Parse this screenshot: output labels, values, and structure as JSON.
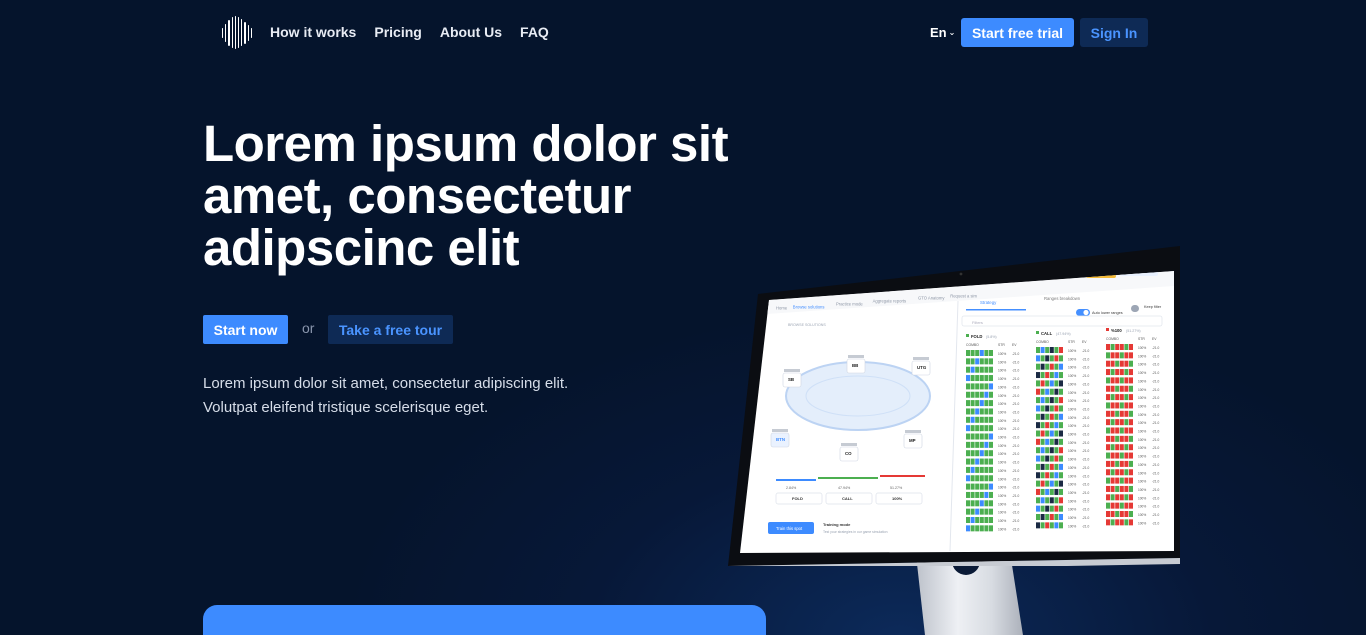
{
  "nav": {
    "logo_name": "equalizer-bars-logo",
    "links": [
      "How it works",
      "Pricing",
      "About Us",
      "FAQ"
    ],
    "language": "En",
    "language_icon": "chevron-down-icon",
    "trial_label": "Start free trial",
    "signin_label": "Sign In"
  },
  "hero": {
    "title": "Lorem ipsum dolor sit amet, consectetur adipscinc elit",
    "start_label": "Start now",
    "or_label": "or",
    "tour_label": "Take a free tour",
    "subtitle_line1": "Lorem ipsum dolor sit amet, consectetur adipiscing elit.",
    "subtitle_line2": "Volutpat eleifend tristique scelerisque eget."
  },
  "app_screen": {
    "nav_items": [
      "Home",
      "Browse solutions",
      "Practice mode",
      "Aggregate reports",
      "GTO Anatomy",
      "Request a sim"
    ],
    "upgrade_label": "UPGRADE",
    "profile_label": "Go to Profile",
    "tabs": [
      "Strategy",
      "Ranges breakdown"
    ],
    "auto_label": "Auto lower ranges",
    "keep_label": "Keep filter",
    "filter_placeholder": "Filters",
    "positions": [
      "SB",
      "BB",
      "UTG",
      "BTN",
      "CO",
      "MP"
    ],
    "columns": [
      {
        "name": "FOLD",
        "pct": "(5.8%)",
        "color": "#4caf50"
      },
      {
        "name": "CALL",
        "pct": "(47.94%)",
        "color": "#4caf50"
      },
      {
        "name": "%100",
        "pct": "(51.27%)",
        "color": "#e53935"
      }
    ],
    "subheads": [
      "COMBO",
      "STR",
      "EV"
    ],
    "action_buttons": [
      "FOLD",
      "CALL",
      "100%"
    ],
    "action_pcts": [
      "2.84%",
      "47.94%",
      "51.27%"
    ],
    "train_label": "Train this spot",
    "training_title": "Training mode",
    "training_desc": "Test your strategies in our game simulation"
  },
  "colors": {
    "accent": "#3d8bff",
    "background": "#05142c",
    "secondary_button": "#0e2a55"
  }
}
